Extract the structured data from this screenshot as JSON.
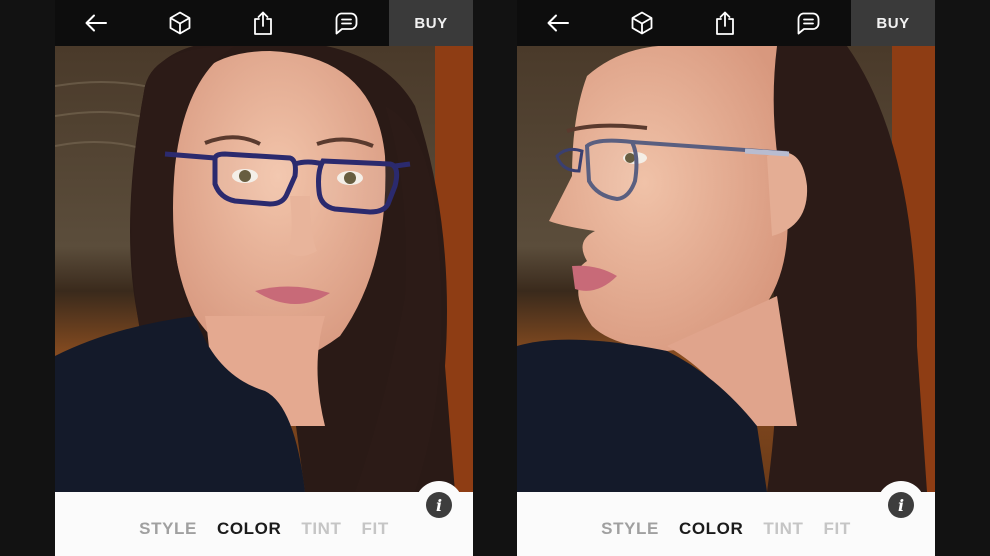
{
  "screens": [
    {
      "view": "front",
      "toolbar": {
        "back_icon": "arrow-left-icon",
        "cube_icon": "3d-cube-icon",
        "share_icon": "share-icon",
        "chat_icon": "chat-bubble-icon",
        "buy_label": "BUY"
      },
      "photo": {
        "description": "Woman facing camera wearing navy blue eyeglasses"
      },
      "info_label": "i",
      "tabs": [
        {
          "label": "STYLE",
          "state": "inactive"
        },
        {
          "label": "COLOR",
          "state": "active"
        },
        {
          "label": "TINT",
          "state": "disabled"
        },
        {
          "label": "FIT",
          "state": "disabled"
        }
      ]
    },
    {
      "view": "profile",
      "toolbar": {
        "back_icon": "arrow-left-icon",
        "cube_icon": "3d-cube-icon",
        "share_icon": "share-icon",
        "chat_icon": "chat-bubble-icon",
        "buy_label": "BUY"
      },
      "photo": {
        "description": "Woman in left-facing profile wearing navy blue eyeglasses"
      },
      "info_label": "i",
      "tabs": [
        {
          "label": "STYLE",
          "state": "inactive"
        },
        {
          "label": "COLOR",
          "state": "active"
        },
        {
          "label": "TINT",
          "state": "disabled"
        },
        {
          "label": "FIT",
          "state": "disabled"
        }
      ]
    }
  ],
  "colors": {
    "toolbar_bg": "#0d0d0d",
    "buy_bg": "#3a3a3a",
    "panel_bg": "#fbfbfb",
    "tab_active": "#1b1b1b",
    "tab_inactive": "#a0a0a0",
    "tab_disabled": "#c5c5c5",
    "frame_color": "#2b2a6e"
  }
}
